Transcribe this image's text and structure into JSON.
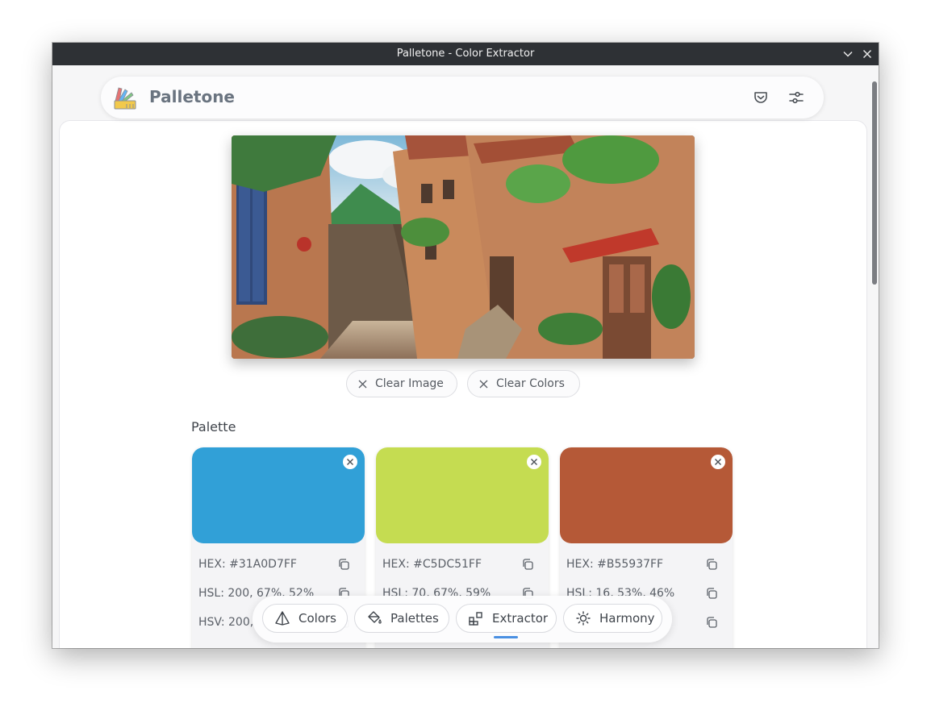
{
  "window": {
    "title": "Palletone - Color Extractor"
  },
  "app": {
    "name": "Palletone"
  },
  "actions": {
    "clear_image": "Clear Image",
    "clear_colors": "Clear Colors"
  },
  "palette": {
    "title": "Palette",
    "colors": [
      {
        "hex": "HEX: #31A0D7FF",
        "hsl": "HSL: 200, 67%, 52%",
        "hsv": "HSV: 200,",
        "swatch": "#31a0d7"
      },
      {
        "hex": "HEX: #C5DC51FF",
        "hsl": "HSL: 70, 67%, 59%",
        "hsv": "",
        "swatch": "#c5dc51"
      },
      {
        "hex": "HEX: #B55937FF",
        "hsl": "HSL: 16, 53%, 46%",
        "hsv": "",
        "swatch": "#b55937"
      }
    ]
  },
  "nav": {
    "items": [
      {
        "label": "Colors",
        "icon": "prism-icon"
      },
      {
        "label": "Palettes",
        "icon": "paint-bucket-icon"
      },
      {
        "label": "Extractor",
        "icon": "extractor-icon",
        "active": true
      },
      {
        "label": "Harmony",
        "icon": "sun-icon"
      }
    ]
  },
  "colors": {
    "accent": "#4a90e2",
    "titlebar": "#2e3135"
  }
}
